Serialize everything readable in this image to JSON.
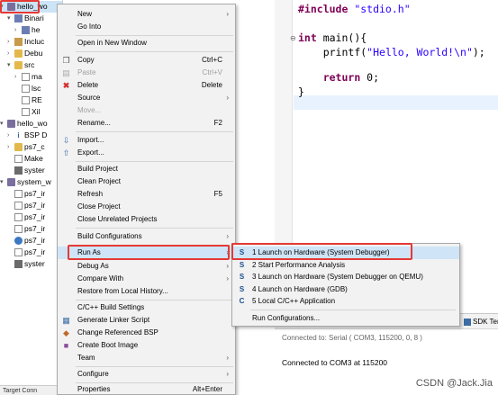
{
  "explorer": {
    "items": [
      {
        "label": "hello_wo",
        "expanded": true
      },
      {
        "label": "Binari"
      },
      {
        "label": "he"
      },
      {
        "label": "Incluc"
      },
      {
        "label": "Debu"
      },
      {
        "label": "src"
      },
      {
        "label": "ma"
      },
      {
        "label": "lsc"
      },
      {
        "label": "RE"
      },
      {
        "label": "Xil"
      },
      {
        "label": "hello_wo"
      },
      {
        "label": "BSP D"
      },
      {
        "label": "ps7_c"
      },
      {
        "label": "Make"
      },
      {
        "label": "syster"
      },
      {
        "label": "system_w"
      },
      {
        "label": "ps7_ir"
      },
      {
        "label": "ps7_ir"
      },
      {
        "label": "ps7_ir"
      },
      {
        "label": "ps7_ir"
      },
      {
        "label": "ps7_ir"
      },
      {
        "label": "ps7_ir"
      },
      {
        "label": "syster"
      }
    ],
    "footer": "Target Conn"
  },
  "editor": {
    "lines": [
      {
        "kw": "#include",
        "rest": " \"stdio.h\""
      },
      {
        "kw": "int",
        "rest": " main(){"
      },
      {
        "indent": "    ",
        "text": "printf(",
        "str": "\"Hello, World!\\n\"",
        "tail": ");"
      },
      {
        "indent": "    ",
        "kw": "return",
        "rest": " 0;"
      },
      {
        "text": "}"
      }
    ]
  },
  "context_menu": {
    "items": [
      {
        "label": "New",
        "submenu": true
      },
      {
        "label": "Go Into"
      },
      {
        "label": "Open in New Window"
      },
      {
        "label": "Copy",
        "shortcut": "Ctrl+C"
      },
      {
        "label": "Paste",
        "shortcut": "Ctrl+V",
        "disabled": true
      },
      {
        "label": "Delete",
        "shortcut": "Delete"
      },
      {
        "label": "Source",
        "submenu": true
      },
      {
        "label": "Move...",
        "disabled": true
      },
      {
        "label": "Rename...",
        "shortcut": "F2"
      },
      {
        "label": "Import..."
      },
      {
        "label": "Export..."
      },
      {
        "label": "Build Project"
      },
      {
        "label": "Clean Project"
      },
      {
        "label": "Refresh",
        "shortcut": "F5"
      },
      {
        "label": "Close Project"
      },
      {
        "label": "Close Unrelated Projects"
      },
      {
        "label": "Build Configurations",
        "submenu": true
      },
      {
        "label": "Run As",
        "submenu": true,
        "highlighted": true
      },
      {
        "label": "Debug As",
        "submenu": true
      },
      {
        "label": "Compare With",
        "submenu": true
      },
      {
        "label": "Restore from Local History..."
      },
      {
        "label": "C/C++ Build Settings"
      },
      {
        "label": "Generate Linker Script"
      },
      {
        "label": "Change Referenced BSP"
      },
      {
        "label": "Create Boot Image"
      },
      {
        "label": "Team",
        "submenu": true
      },
      {
        "label": "Configure",
        "submenu": true
      },
      {
        "label": "Properties",
        "shortcut": "Alt+Enter"
      }
    ]
  },
  "run_as_submenu": {
    "items": [
      {
        "label": "1 Launch on Hardware (System Debugger)",
        "icon": "S",
        "highlighted": true
      },
      {
        "label": "2 Start Performance Analysis",
        "icon": "S"
      },
      {
        "label": "3 Launch on Hardware (System Debugger on QEMU)",
        "icon": "S"
      },
      {
        "label": "4 Launch on Hardware (GDB)",
        "icon": "S"
      },
      {
        "label": "5 Local C/C++ Application",
        "icon": "C"
      },
      {
        "label": "Run Configurations..."
      }
    ]
  },
  "console": {
    "tab": "SDK Ter",
    "header": "Connected to: Serial ( COM3, 115200, 0, 8 )",
    "output": "Connected to COM3 at 115200"
  },
  "watermark": "CSDN @Jack.Jia",
  "colors": {
    "highlight": "#cfe5f7",
    "annotation_red": "#e53935",
    "keyword": "#7f0055",
    "string": "#2a00ff"
  }
}
